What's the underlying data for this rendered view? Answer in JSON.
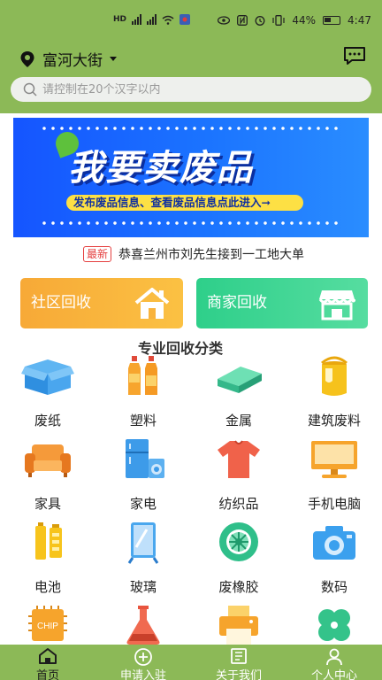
{
  "status_bar": {
    "left_icons": [
      "hd-icon",
      "4g-signal-icon",
      "5g-signal-icon",
      "wifi-icon",
      "app-icon"
    ],
    "right_icons": [
      "eye-icon",
      "nfc-icon",
      "alarm-icon",
      "vibrate-icon"
    ],
    "battery_percent": "44%",
    "time": "4:47"
  },
  "header": {
    "location": "富河大街",
    "search_placeholder": "请控制在20个汉字以内"
  },
  "banner": {
    "title": "我要卖废品",
    "subtitle": "发布废品信息、查看废品信息点此进入➞"
  },
  "news": {
    "badge": "最新",
    "text": "恭喜兰州市刘先生接到一工地大单"
  },
  "cards": {
    "community": "社区回收",
    "merchant": "商家回收"
  },
  "section_title": "专业回收分类",
  "categories": [
    {
      "label": "废纸",
      "icon": "cardboard-box-icon"
    },
    {
      "label": "塑料",
      "icon": "plastic-bottles-icon"
    },
    {
      "label": "金属",
      "icon": "metal-ingot-icon"
    },
    {
      "label": "建筑废料",
      "icon": "paint-bucket-icon"
    },
    {
      "label": "家具",
      "icon": "sofa-icon"
    },
    {
      "label": "家电",
      "icon": "appliances-icon"
    },
    {
      "label": "纺织品",
      "icon": "t-shirt-icon"
    },
    {
      "label": "手机电脑",
      "icon": "computer-icon"
    },
    {
      "label": "电池",
      "icon": "battery-icon"
    },
    {
      "label": "玻璃",
      "icon": "glass-mirror-icon"
    },
    {
      "label": "废橡胶",
      "icon": "tire-icon"
    },
    {
      "label": "数码",
      "icon": "camera-icon"
    },
    {
      "label": "",
      "icon": "chip-icon",
      "chip_text": "CHIP"
    },
    {
      "label": "",
      "icon": "flask-icon"
    },
    {
      "label": "",
      "icon": "printer-icon"
    },
    {
      "label": "",
      "icon": "clover-icon"
    }
  ],
  "tabs": [
    {
      "label": "首页",
      "icon": "home-icon",
      "active": true
    },
    {
      "label": "申请入驻",
      "icon": "plus-circle-icon",
      "active": false
    },
    {
      "label": "关于我们",
      "icon": "document-icon",
      "active": false
    },
    {
      "label": "个人中心",
      "icon": "user-icon",
      "active": false
    }
  ],
  "colors": {
    "primary_green": "#8cb957",
    "banner_blue": "#1b6bff",
    "banner_yellow": "#fde044",
    "community_orange": "#f8b23c",
    "merchant_green": "#3fd594",
    "news_red": "#e54040"
  }
}
